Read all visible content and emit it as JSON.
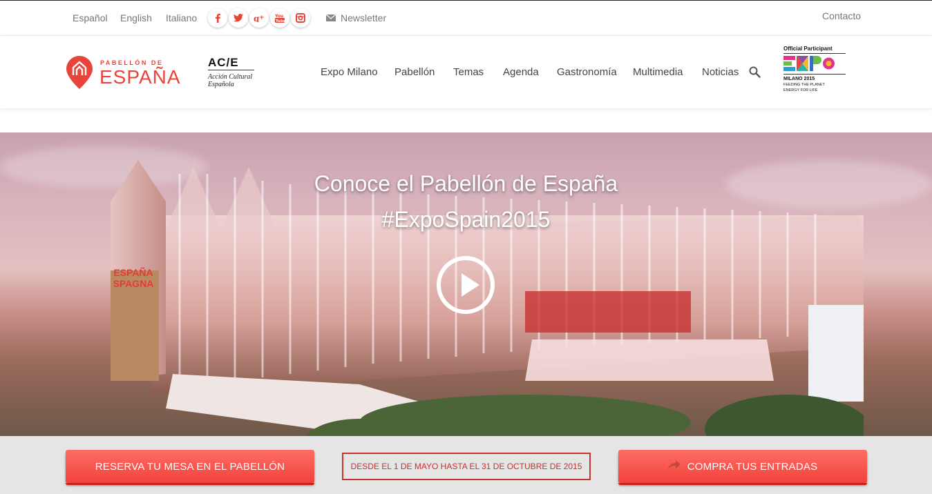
{
  "topbar": {
    "languages": [
      "Español",
      "English",
      "Italiano"
    ],
    "social_icons": [
      "facebook-icon",
      "twitter-icon",
      "google-plus-icon",
      "youtube-icon",
      "instagram-icon"
    ],
    "newsletter_label": "Newsletter",
    "contact_label": "Contacto"
  },
  "header": {
    "logo_small": "PABELLÓN DE",
    "logo_big": "ESPAÑA",
    "ace_title": "AC/E",
    "ace_sub_1": "Acción Cultural",
    "ace_sub_2": "Española",
    "nav": [
      "Expo Milano",
      "Pabellón",
      "Temas",
      "Agenda",
      "Gastronomía",
      "Multimedia",
      "Noticias"
    ],
    "expo": {
      "official": "Official Participant",
      "city": "MILANO 2015",
      "tagline_1": "FEEDING THE PLANET",
      "tagline_2": "ENERGY FOR LIFE"
    }
  },
  "hero": {
    "title_line_1": "Conoce el Pabellón de España",
    "title_line_2": "#ExpoSpain2015",
    "sign_line_1": "ESPAÑA",
    "sign_line_2": "SPAGNA"
  },
  "actions": {
    "reserve_label": "RESERVA TU MESA EN EL PABELLÓN",
    "dates_label": "DESDE EL 1 DE MAYO HASTA EL 31 DE OCTUBRE DE 2015",
    "tickets_label": "COMPRA TUS ENTRADAS"
  },
  "colors": {
    "brand_red": "#e8443a",
    "button_red": "#f0423b",
    "band_gray": "#e5e5e5"
  }
}
